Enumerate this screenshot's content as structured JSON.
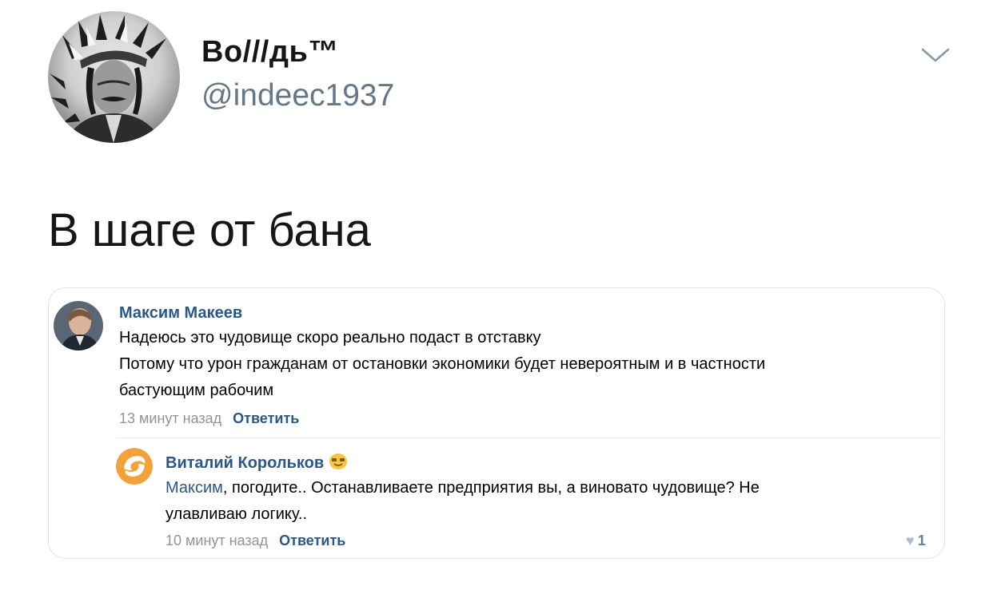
{
  "tweet": {
    "display_name": "Во///дь™",
    "handle": "@indeec1937",
    "text": "В шаге от бана",
    "menu_icon": "chevron-down-icon"
  },
  "embedded_screenshot": {
    "comment": {
      "author": "Максим Макеев",
      "lines": [
        "Надеюсь это чудовище скоро реально подаст в отставку",
        "Потому что урон гражданам от остановки экономики будет невероятным и в частности",
        "бастующим рабочим"
      ],
      "time": "13 минут назад",
      "reply_label": "Ответить"
    },
    "reply": {
      "author": "Виталий Корольков",
      "author_emoji": "smiling-face-icon",
      "mention": "Максим",
      "line1_rest": ", погодите.. Останавливаете предприятия вы, а виновато чудовище? Не",
      "line2": "улавливаю логику..",
      "time": "10 минут назад",
      "reply_label": "Ответить",
      "likes": "1"
    }
  },
  "colors": {
    "name_text": "#14171a",
    "handle_text": "#657786",
    "vk_link": "#2a5885",
    "vk_meta": "#939393"
  }
}
